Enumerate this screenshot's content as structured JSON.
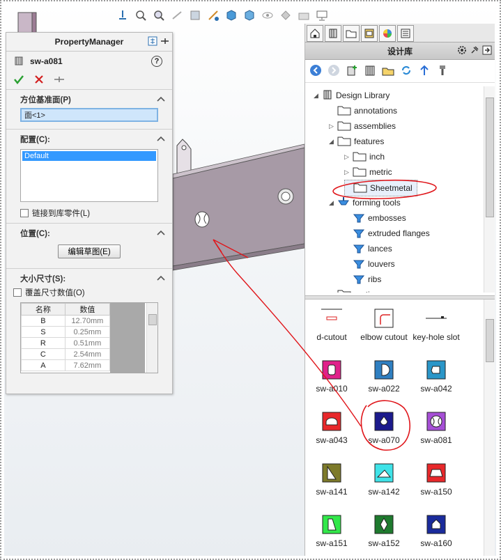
{
  "property_manager": {
    "title": "PropertyManager",
    "feature_name": "sw-a081",
    "sections": {
      "orientation": {
        "title": "方位基准面(P)",
        "face_value": "面<1>"
      },
      "configuration": {
        "title": "配置(C):",
        "selected": "Default",
        "link_label": "链接到库零件(L)"
      },
      "position": {
        "title": "位置(C):",
        "edit_button": "编辑草图(E)"
      },
      "size": {
        "title": "大小尺寸(S):",
        "override_label": "覆盖尺寸数值(O)",
        "columns": [
          "名称",
          "数值"
        ],
        "rows": [
          {
            "name": "B",
            "value": "12.70mm"
          },
          {
            "name": "S",
            "value": "0.25mm"
          },
          {
            "name": "R",
            "value": "0.51mm"
          },
          {
            "name": "C",
            "value": "2.54mm"
          },
          {
            "name": "A",
            "value": "7.62mm"
          }
        ]
      }
    }
  },
  "design_library": {
    "title": "设计库",
    "tree": [
      {
        "label": "Design Library"
      },
      {
        "label": "annotations"
      },
      {
        "label": "assemblies"
      },
      {
        "label": "features"
      },
      {
        "label": "inch"
      },
      {
        "label": "metric"
      },
      {
        "label": "Sheetmetal"
      },
      {
        "label": "forming tools"
      },
      {
        "label": "embosses"
      },
      {
        "label": "extruded flanges"
      },
      {
        "label": "lances"
      },
      {
        "label": "louvers"
      },
      {
        "label": "ribs"
      },
      {
        "label": "motion"
      }
    ],
    "gallery": [
      {
        "label": "d-cutout",
        "color": "#ffffff"
      },
      {
        "label": "elbow cutout",
        "color": "#ffffff"
      },
      {
        "label": "key-hole slot",
        "color": "#ffffff"
      },
      {
        "label": "sw-a010",
        "color": "#e0218a"
      },
      {
        "label": "sw-a022",
        "color": "#2f7fc1"
      },
      {
        "label": "sw-a042",
        "color": "#2a96c8"
      },
      {
        "label": "sw-a043",
        "color": "#e8282b"
      },
      {
        "label": "sw-a070",
        "color": "#1c1a8c"
      },
      {
        "label": "sw-a081",
        "color": "#a64fd6"
      },
      {
        "label": "sw-a141",
        "color": "#7d7a2a"
      },
      {
        "label": "sw-a142",
        "color": "#3fe3e8"
      },
      {
        "label": "sw-a150",
        "color": "#e8282b"
      },
      {
        "label": "sw-a151",
        "color": "#32e84a"
      },
      {
        "label": "sw-a152",
        "color": "#1e7a2e"
      },
      {
        "label": "sw-a160",
        "color": "#1a2b9c"
      }
    ]
  },
  "colors": {
    "annotation": "#e0161b",
    "selection": "#3399ff",
    "plate": "#a79aa6"
  }
}
